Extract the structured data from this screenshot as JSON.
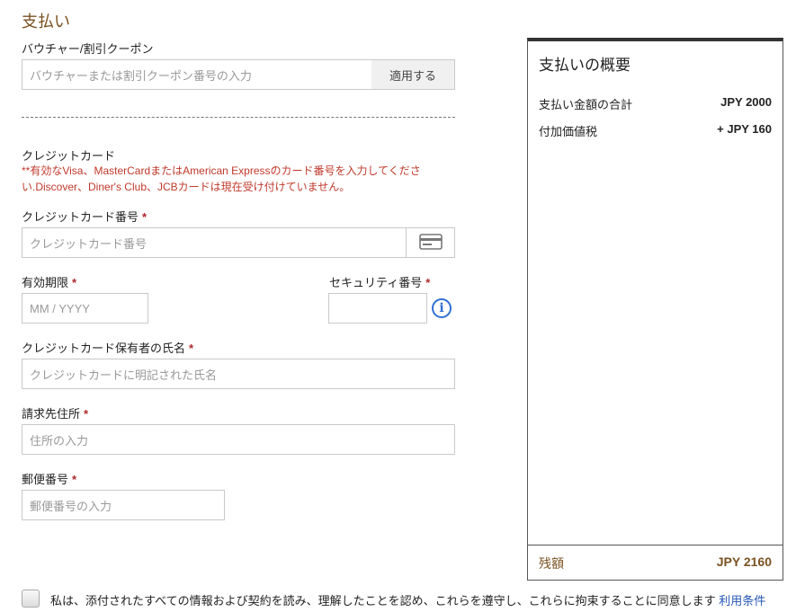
{
  "page": {
    "title": "支払い"
  },
  "voucher": {
    "label": "バウチャー/割引クーポン",
    "placeholder": "バウチャーまたは割引クーポン番号の入力",
    "apply_label": "適用する"
  },
  "credit_card": {
    "section_label": "クレジットカード",
    "notice": "**有効なVisa、MasterCardまたはAmerican Expressのカード番号を入力してください.Discover、Diner's Club、JCBカードは現在受け付けていません。",
    "number_label": "クレジットカード番号",
    "number_placeholder": "クレジットカード番号",
    "card_icon": "credit-card-icon",
    "expiry_label": "有効期限",
    "expiry_placeholder": "MM / YYYY",
    "security_label": "セキュリティ番号",
    "info_icon": "info-icon",
    "info_glyph": "i",
    "holder_label": "クレジットカード保有者の氏名",
    "holder_placeholder": "クレジットカードに明記された氏名",
    "address_label": "請求先住所",
    "address_placeholder": "住所の入力",
    "postal_label": "郵便番号",
    "postal_placeholder": "郵便番号の入力",
    "required_mark": "*"
  },
  "summary": {
    "title": "支払いの概要",
    "total_label": "支払い金額の合計",
    "total_value": "JPY 2000",
    "tax_label": "付加価値税",
    "tax_value": "+ JPY 160",
    "balance_label": "残額",
    "balance_value": "JPY 2160"
  },
  "agreement": {
    "text": "私は、添付されたすべての情報および契約を読み、理解したことを認め、これらを遵守し、これらに拘束することに同意します",
    "terms_link": "利用条件"
  },
  "colors": {
    "accent_brown": "#7a5220",
    "required_red": "#b0282b",
    "link_blue": "#2456b5",
    "info_blue": "#2f6fd6"
  }
}
